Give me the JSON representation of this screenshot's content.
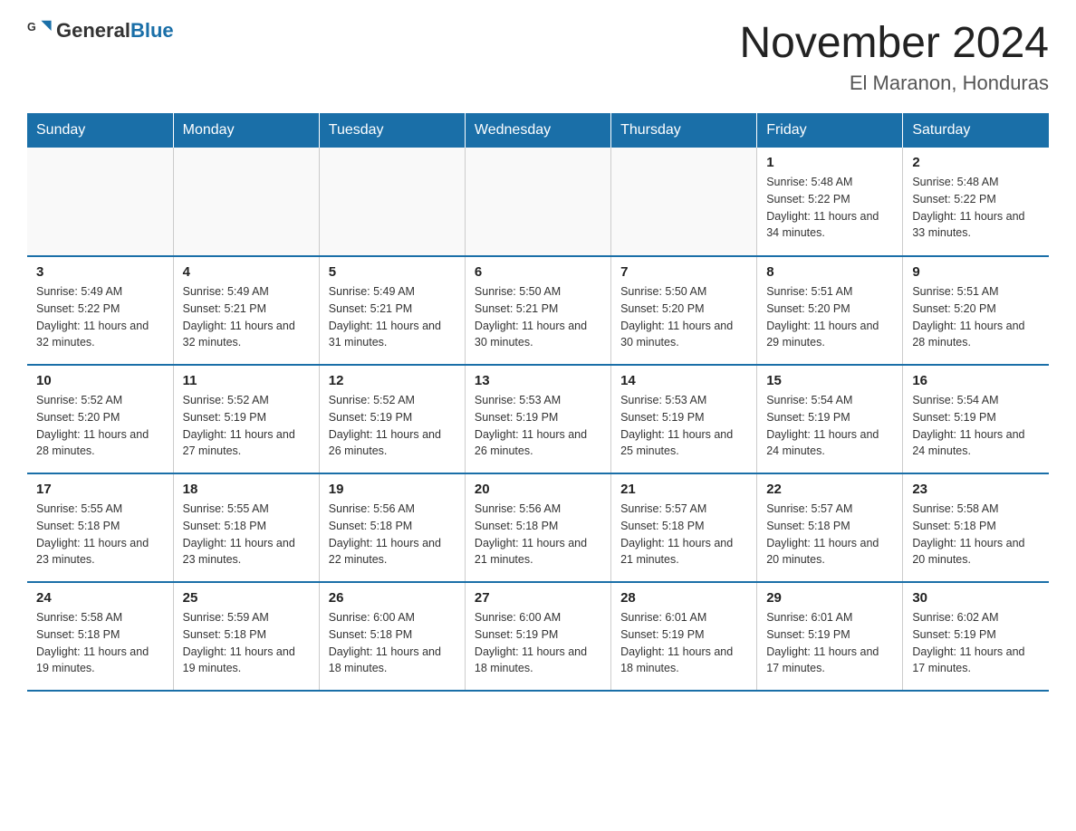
{
  "logo": {
    "text_general": "General",
    "text_blue": "Blue"
  },
  "title": "November 2024",
  "subtitle": "El Maranon, Honduras",
  "days_of_week": [
    "Sunday",
    "Monday",
    "Tuesday",
    "Wednesday",
    "Thursday",
    "Friday",
    "Saturday"
  ],
  "weeks": [
    [
      {
        "day": "",
        "info": ""
      },
      {
        "day": "",
        "info": ""
      },
      {
        "day": "",
        "info": ""
      },
      {
        "day": "",
        "info": ""
      },
      {
        "day": "",
        "info": ""
      },
      {
        "day": "1",
        "info": "Sunrise: 5:48 AM\nSunset: 5:22 PM\nDaylight: 11 hours and 34 minutes."
      },
      {
        "day": "2",
        "info": "Sunrise: 5:48 AM\nSunset: 5:22 PM\nDaylight: 11 hours and 33 minutes."
      }
    ],
    [
      {
        "day": "3",
        "info": "Sunrise: 5:49 AM\nSunset: 5:22 PM\nDaylight: 11 hours and 32 minutes."
      },
      {
        "day": "4",
        "info": "Sunrise: 5:49 AM\nSunset: 5:21 PM\nDaylight: 11 hours and 32 minutes."
      },
      {
        "day": "5",
        "info": "Sunrise: 5:49 AM\nSunset: 5:21 PM\nDaylight: 11 hours and 31 minutes."
      },
      {
        "day": "6",
        "info": "Sunrise: 5:50 AM\nSunset: 5:21 PM\nDaylight: 11 hours and 30 minutes."
      },
      {
        "day": "7",
        "info": "Sunrise: 5:50 AM\nSunset: 5:20 PM\nDaylight: 11 hours and 30 minutes."
      },
      {
        "day": "8",
        "info": "Sunrise: 5:51 AM\nSunset: 5:20 PM\nDaylight: 11 hours and 29 minutes."
      },
      {
        "day": "9",
        "info": "Sunrise: 5:51 AM\nSunset: 5:20 PM\nDaylight: 11 hours and 28 minutes."
      }
    ],
    [
      {
        "day": "10",
        "info": "Sunrise: 5:52 AM\nSunset: 5:20 PM\nDaylight: 11 hours and 28 minutes."
      },
      {
        "day": "11",
        "info": "Sunrise: 5:52 AM\nSunset: 5:19 PM\nDaylight: 11 hours and 27 minutes."
      },
      {
        "day": "12",
        "info": "Sunrise: 5:52 AM\nSunset: 5:19 PM\nDaylight: 11 hours and 26 minutes."
      },
      {
        "day": "13",
        "info": "Sunrise: 5:53 AM\nSunset: 5:19 PM\nDaylight: 11 hours and 26 minutes."
      },
      {
        "day": "14",
        "info": "Sunrise: 5:53 AM\nSunset: 5:19 PM\nDaylight: 11 hours and 25 minutes."
      },
      {
        "day": "15",
        "info": "Sunrise: 5:54 AM\nSunset: 5:19 PM\nDaylight: 11 hours and 24 minutes."
      },
      {
        "day": "16",
        "info": "Sunrise: 5:54 AM\nSunset: 5:19 PM\nDaylight: 11 hours and 24 minutes."
      }
    ],
    [
      {
        "day": "17",
        "info": "Sunrise: 5:55 AM\nSunset: 5:18 PM\nDaylight: 11 hours and 23 minutes."
      },
      {
        "day": "18",
        "info": "Sunrise: 5:55 AM\nSunset: 5:18 PM\nDaylight: 11 hours and 23 minutes."
      },
      {
        "day": "19",
        "info": "Sunrise: 5:56 AM\nSunset: 5:18 PM\nDaylight: 11 hours and 22 minutes."
      },
      {
        "day": "20",
        "info": "Sunrise: 5:56 AM\nSunset: 5:18 PM\nDaylight: 11 hours and 21 minutes."
      },
      {
        "day": "21",
        "info": "Sunrise: 5:57 AM\nSunset: 5:18 PM\nDaylight: 11 hours and 21 minutes."
      },
      {
        "day": "22",
        "info": "Sunrise: 5:57 AM\nSunset: 5:18 PM\nDaylight: 11 hours and 20 minutes."
      },
      {
        "day": "23",
        "info": "Sunrise: 5:58 AM\nSunset: 5:18 PM\nDaylight: 11 hours and 20 minutes."
      }
    ],
    [
      {
        "day": "24",
        "info": "Sunrise: 5:58 AM\nSunset: 5:18 PM\nDaylight: 11 hours and 19 minutes."
      },
      {
        "day": "25",
        "info": "Sunrise: 5:59 AM\nSunset: 5:18 PM\nDaylight: 11 hours and 19 minutes."
      },
      {
        "day": "26",
        "info": "Sunrise: 6:00 AM\nSunset: 5:18 PM\nDaylight: 11 hours and 18 minutes."
      },
      {
        "day": "27",
        "info": "Sunrise: 6:00 AM\nSunset: 5:19 PM\nDaylight: 11 hours and 18 minutes."
      },
      {
        "day": "28",
        "info": "Sunrise: 6:01 AM\nSunset: 5:19 PM\nDaylight: 11 hours and 18 minutes."
      },
      {
        "day": "29",
        "info": "Sunrise: 6:01 AM\nSunset: 5:19 PM\nDaylight: 11 hours and 17 minutes."
      },
      {
        "day": "30",
        "info": "Sunrise: 6:02 AM\nSunset: 5:19 PM\nDaylight: 11 hours and 17 minutes."
      }
    ]
  ]
}
